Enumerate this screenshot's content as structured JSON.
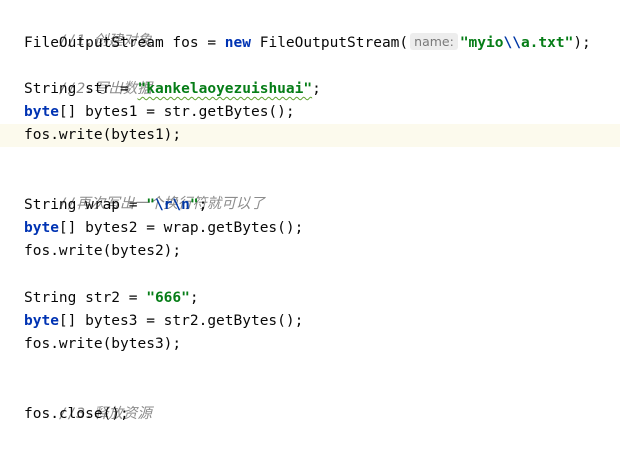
{
  "code": {
    "comment_create": "//1.创建对象",
    "l2_type": "FileOutputStream",
    "l2_decl": " fos = ",
    "l2_new": "new",
    "l2_ctor": " FileOutputStream(",
    "l2_hint": "name:",
    "l2_str_a": "\"myio",
    "l2_str_esc": "\\\\",
    "l2_str_b": "a.txt\"",
    "l2_end": ");",
    "comment_write": "//2.写出数据",
    "l4_decl": "String str = ",
    "l4_str": "\"kankelaoyezuishuai\"",
    "l4_end": ";",
    "l5_kw": "byte",
    "l5_rest": "[] bytes1 = str.getBytes();",
    "l6": "fos.write(bytes1);",
    "comment_newline": "//再次写出一个换行符就可以了",
    "l9_decl": "String wrap = ",
    "l9_q1": "\"",
    "l9_esc": "\\r\\n",
    "l9_q2": "\"",
    "l9_end": ";",
    "l10_kw": "byte",
    "l10_rest": "[] bytes2 = wrap.getBytes();",
    "l11": "fos.write(bytes2);",
    "l13_decl": "String str2 = ",
    "l13_str": "\"666\"",
    "l13_end": ";",
    "l14_kw": "byte",
    "l14_rest": "[] bytes3 = str2.getBytes();",
    "l15": "fos.write(bytes3);",
    "comment_release": "//3.释放资源",
    "l18": "fos.close();"
  },
  "colors": {
    "comment": "#8c8c8c",
    "keyword": "#0033b3",
    "string": "#067d17",
    "escape": "#0037a6",
    "caret_line": "#fcfaed",
    "background": "#ffffff"
  }
}
